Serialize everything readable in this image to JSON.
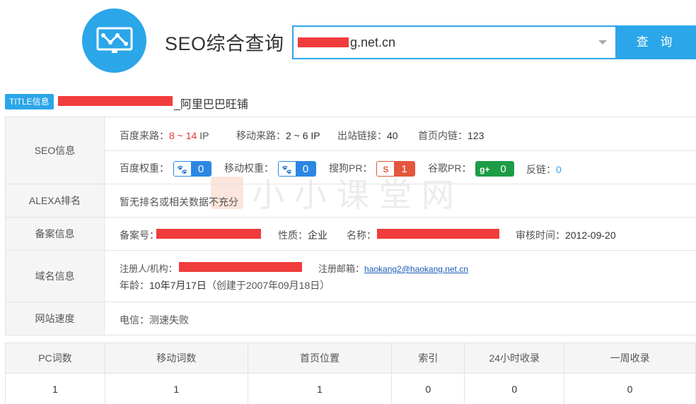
{
  "header": {
    "title": "SEO综合查询",
    "search_value": "g.net.cn",
    "search_button": "查 询"
  },
  "title_row": {
    "badge": "TITLE信息",
    "text": "_阿里巴巴旺铺"
  },
  "seo": {
    "label": "SEO信息",
    "baidu_traffic_label": "百度来路：",
    "baidu_traffic_low": "8",
    "baidu_traffic_sep": " ~ ",
    "baidu_traffic_high": "14",
    "baidu_traffic_unit": " IP",
    "mobile_traffic_label": "移动来路：",
    "mobile_traffic_value": "2 ~ 6 IP",
    "outlinks_label": "出站链接：",
    "outlinks_value": "40",
    "homepage_links_label": "首页内链：",
    "homepage_links_value": "123",
    "baidu_weight_label": "百度权重：",
    "baidu_weight_value": "0",
    "mobile_weight_label": "移动权重：",
    "mobile_weight_value": "0",
    "sogou_pr_label": "搜狗PR：",
    "sogou_pr_value": "1",
    "google_pr_label": "谷歌PR：",
    "google_pr_value": "0",
    "backlinks_label": "反链：",
    "backlinks_value": "0"
  },
  "alexa": {
    "label": "ALEXA排名",
    "value": "暂无排名或相关数据不充分"
  },
  "icp": {
    "label": "备案信息",
    "number_label": "备案号：",
    "type_label": "性质：",
    "type_value": "企业",
    "name_label": "名称：",
    "audit_label": "审核时间：",
    "audit_value": "2012-09-20"
  },
  "domain": {
    "label": "域名信息",
    "registrant_label": "注册人/机构：",
    "email_label": "注册邮箱：",
    "email_value": "haokang2@haokang.net.cn",
    "age_label": "年龄：",
    "age_value": "10年7月17日",
    "created_value": "（创建于2007年09月18日）"
  },
  "speed": {
    "label": "网站速度",
    "value": "电信：测速失败"
  },
  "stats": {
    "headers": [
      "PC词数",
      "移动词数",
      "首页位置",
      "索引",
      "24小时收录",
      "一周收录"
    ],
    "values": [
      "1",
      "1",
      "1",
      "0",
      "0",
      "0"
    ]
  },
  "watermark": "小小课堂网",
  "colors": {
    "accent": "#2ba6e9",
    "redact": "#f03c3c"
  }
}
